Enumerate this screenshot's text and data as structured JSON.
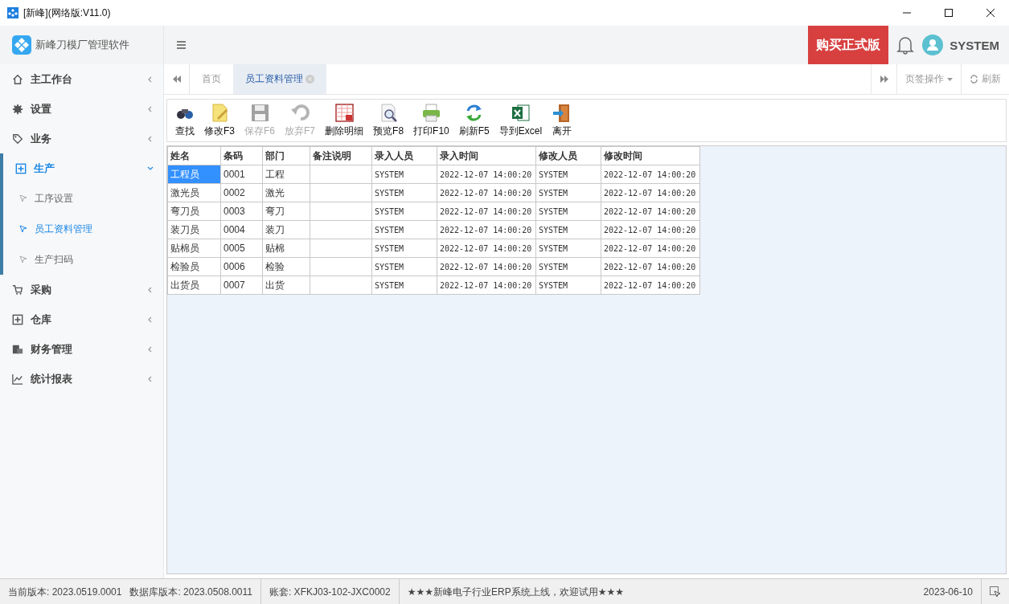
{
  "window": {
    "title": "[新峰](网络版:V11.0)"
  },
  "header": {
    "app_name": "新峰刀模厂管理软件",
    "buy_button": "购买正式版",
    "user": "SYSTEM"
  },
  "sidebar": {
    "items": [
      {
        "label": "主工作台",
        "expanded": false
      },
      {
        "label": "设置",
        "expanded": false
      },
      {
        "label": "业务",
        "expanded": false
      },
      {
        "label": "生产",
        "expanded": true,
        "children": [
          {
            "label": "工序设置",
            "selected": false
          },
          {
            "label": "员工资料管理",
            "selected": true
          },
          {
            "label": "生产扫码",
            "selected": false
          }
        ]
      },
      {
        "label": "采购",
        "expanded": false
      },
      {
        "label": "仓库",
        "expanded": false
      },
      {
        "label": "财务管理",
        "expanded": false
      },
      {
        "label": "统计报表",
        "expanded": false
      }
    ]
  },
  "tabs": [
    {
      "label": "首页",
      "selected": false,
      "closable": false
    },
    {
      "label": "员工资料管理",
      "selected": true,
      "closable": true
    }
  ],
  "tab_actions": {
    "page_ops": "页签操作",
    "refresh": "刷新"
  },
  "toolbar": [
    {
      "label": "查找",
      "disabled": false
    },
    {
      "label": "修改F3",
      "disabled": false
    },
    {
      "label": "保存F6",
      "disabled": true
    },
    {
      "label": "放弃F7",
      "disabled": true
    },
    {
      "label": "删除明细",
      "disabled": false
    },
    {
      "label": "预览F8",
      "disabled": false
    },
    {
      "label": "打印F10",
      "disabled": false
    },
    {
      "label": "刷新F5",
      "disabled": false
    },
    {
      "label": "导到Excel",
      "disabled": false
    },
    {
      "label": "离开",
      "disabled": false
    }
  ],
  "table": {
    "columns": [
      "姓名",
      "条码",
      "部门",
      "备注说明",
      "录入人员",
      "录入时间",
      "修改人员",
      "修改时间"
    ],
    "rows": [
      {
        "selected": true,
        "cells": [
          "工程员",
          "0001",
          "工程",
          "",
          "SYSTEM",
          "2022-12-07 14:00:20",
          "SYSTEM",
          "2022-12-07 14:00:20"
        ]
      },
      {
        "selected": false,
        "cells": [
          "激光员",
          "0002",
          "激光",
          "",
          "SYSTEM",
          "2022-12-07 14:00:20",
          "SYSTEM",
          "2022-12-07 14:00:20"
        ]
      },
      {
        "selected": false,
        "cells": [
          "弯刀员",
          "0003",
          "弯刀",
          "",
          "SYSTEM",
          "2022-12-07 14:00:20",
          "SYSTEM",
          "2022-12-07 14:00:20"
        ]
      },
      {
        "selected": false,
        "cells": [
          "装刀员",
          "0004",
          "装刀",
          "",
          "SYSTEM",
          "2022-12-07 14:00:20",
          "SYSTEM",
          "2022-12-07 14:00:20"
        ]
      },
      {
        "selected": false,
        "cells": [
          "贴棉员",
          "0005",
          "贴棉",
          "",
          "SYSTEM",
          "2022-12-07 14:00:20",
          "SYSTEM",
          "2022-12-07 14:00:20"
        ]
      },
      {
        "selected": false,
        "cells": [
          "检验员",
          "0006",
          "检验",
          "",
          "SYSTEM",
          "2022-12-07 14:00:20",
          "SYSTEM",
          "2022-12-07 14:00:20"
        ]
      },
      {
        "selected": false,
        "cells": [
          "出货员",
          "0007",
          "出货",
          "",
          "SYSTEM",
          "2022-12-07 14:00:20",
          "SYSTEM",
          "2022-12-07 14:00:20"
        ]
      }
    ]
  },
  "status_bar": [
    "当前版本: 2023.0519.0001",
    "数据库版本: 2023.0508.0011",
    "账套: XFKJ03-102-JXC0002",
    "★★★新峰电子行业ERP系统上线，欢迎试用★★★",
    "2023-06-10"
  ]
}
